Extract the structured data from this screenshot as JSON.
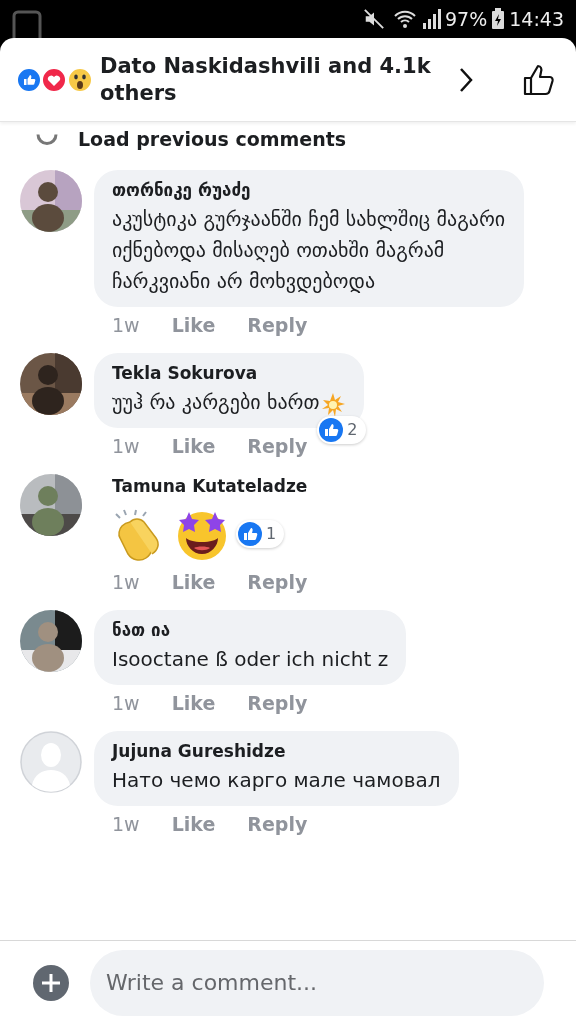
{
  "status_bar": {
    "battery": "97%",
    "time": "14:43"
  },
  "header": {
    "title": "Dato Naskidashvili and 4.1k others"
  },
  "load_previous": "Load previous comments",
  "comments": [
    {
      "kind": "text",
      "name": "თორნიკე რუაძე",
      "text": "აკუსტიკა გურჯაანში ჩემ სახლშიც მაგარი იქნებოდა მისაღებ ოთახში მაგრამ ჩარკვიანი არ მოხვდებოდა",
      "time": "1w",
      "like": "Like",
      "reply": "Reply"
    },
    {
      "kind": "text_emoji",
      "name": "Tekla Sokurova",
      "text": "უუჰ რა კარგები ხართ",
      "time": "1w",
      "like": "Like",
      "reply": "Reply",
      "reactions": "2"
    },
    {
      "kind": "emoji",
      "name": "Tamuna Kutateladze",
      "time": "1w",
      "like": "Like",
      "reply": "Reply",
      "reactions": "1"
    },
    {
      "kind": "text",
      "name": "ნათ ია",
      "text": "Isooctane ß oder ich nicht z",
      "time": "1w",
      "like": "Like",
      "reply": "Reply"
    },
    {
      "kind": "text",
      "avatar": {
        "kind": "default"
      },
      "name": "Jujuna Gureshidze",
      "text": "Нато чемо карго мале чамовал",
      "time": "1w",
      "like": "Like",
      "reply": "Reply"
    }
  ],
  "composer": {
    "placeholder": "Write a comment..."
  }
}
